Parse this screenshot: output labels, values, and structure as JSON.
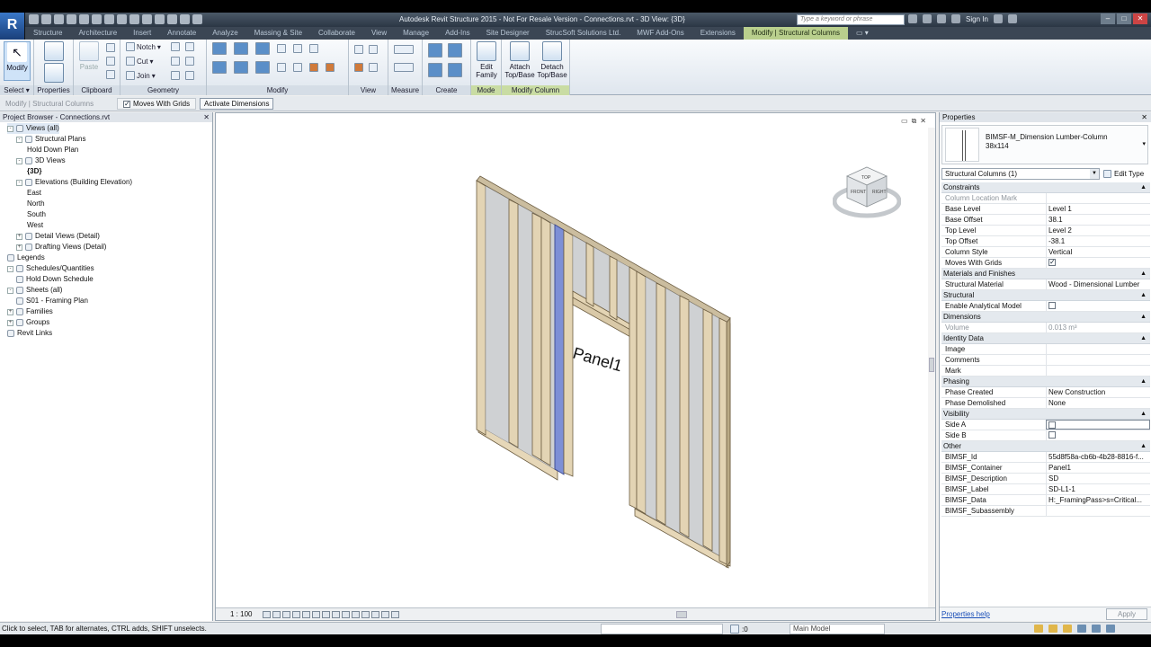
{
  "title_bar": {
    "app_title": "Autodesk Revit Structure 2015 - Not For Resale Version -    Connections.rvt - 3D View: {3D}",
    "search_placeholder": "Type a keyword or phrase",
    "sign_in": "Sign In"
  },
  "ribbon_tabs": [
    "Structure",
    "Architecture",
    "Insert",
    "Annotate",
    "Analyze",
    "Massing & Site",
    "Collaborate",
    "View",
    "Manage",
    "Add-Ins",
    "Site Designer",
    "StrucSoft Solutions Ltd.",
    "MWF Add-Ons",
    "Extensions",
    "Modify | Structural Columns"
  ],
  "ribbon": {
    "select": {
      "label": "Select",
      "modify": "Modify"
    },
    "properties": {
      "label": "Properties"
    },
    "clipboard": {
      "label": "Clipboard",
      "paste": "Paste"
    },
    "geometry": {
      "label": "Geometry",
      "notch": "Notch",
      "cut": "Cut",
      "join": "Join"
    },
    "modify": {
      "label": "Modify"
    },
    "view": {
      "label": "View"
    },
    "measure": {
      "label": "Measure"
    },
    "create": {
      "label": "Create"
    },
    "mode": {
      "label": "Mode",
      "edit_family": "Edit Family"
    },
    "modify_column": {
      "label": "Modify Column",
      "attach": "Attach Top/Base",
      "detach": "Detach Top/Base"
    }
  },
  "options_bar": {
    "context": "Modify | Structural Columns",
    "moves_with_grids": "Moves With Grids",
    "moves_with_grids_checked": true,
    "activate_dimensions": "Activate Dimensions"
  },
  "project_browser": {
    "title": "Project Browser - Connections.rvt",
    "items": [
      {
        "label": "Views (all)",
        "pm": "-",
        "selected": true
      },
      {
        "label": "Structural Plans",
        "pm": "-"
      },
      {
        "label": "Hold Down Plan",
        "pm": ""
      },
      {
        "label": "3D Views",
        "pm": "-"
      },
      {
        "label": "{3D}",
        "pm": "",
        "bold": true
      },
      {
        "label": "Elevations (Building Elevation)",
        "pm": "-"
      },
      {
        "label": "East",
        "pm": ""
      },
      {
        "label": "North",
        "pm": ""
      },
      {
        "label": "South",
        "pm": ""
      },
      {
        "label": "West",
        "pm": ""
      },
      {
        "label": "Detail Views (Detail)",
        "pm": "+"
      },
      {
        "label": "Drafting Views (Detail)",
        "pm": "+"
      },
      {
        "label": "Legends",
        "pm": ""
      },
      {
        "label": "Schedules/Quantities",
        "pm": "-"
      },
      {
        "label": "Hold Down Schedule",
        "pm": ""
      },
      {
        "label": "Sheets (all)",
        "pm": "-"
      },
      {
        "label": "S01 - Framing Plan",
        "pm": ""
      },
      {
        "label": "Families",
        "pm": "+"
      },
      {
        "label": "Groups",
        "pm": "+"
      },
      {
        "label": "Revit Links",
        "pm": ""
      }
    ]
  },
  "viewport": {
    "tag_text": "Panel1",
    "scale": "1 : 100",
    "viewcube": {
      "top": "TOP",
      "front": "FRONT",
      "right": "RIGHT"
    }
  },
  "properties": {
    "title": "Properties",
    "type_name_line1": "BIMSF-M_Dimension Lumber-Column",
    "type_name_line2": "38x114",
    "filter": "Structural Columns (1)",
    "edit_type": "Edit Type",
    "groups": [
      {
        "name": "Constraints",
        "rows": [
          {
            "k": "Column Location Mark",
            "v": "",
            "dim": true
          },
          {
            "k": "Base Level",
            "v": "Level 1"
          },
          {
            "k": "Base Offset",
            "v": "38.1"
          },
          {
            "k": "Top Level",
            "v": "Level 2"
          },
          {
            "k": "Top Offset",
            "v": "-38.1"
          },
          {
            "k": "Column Style",
            "v": "Vertical"
          },
          {
            "k": "Moves With Grids",
            "v": "",
            "check": true,
            "checked": true
          }
        ]
      },
      {
        "name": "Materials and Finishes",
        "rows": [
          {
            "k": "Structural Material",
            "v": "Wood - Dimensional Lumber"
          }
        ]
      },
      {
        "name": "Structural",
        "rows": [
          {
            "k": "Enable Analytical Model",
            "v": "",
            "check": true,
            "checked": false
          }
        ]
      },
      {
        "name": "Dimensions",
        "rows": [
          {
            "k": "Volume",
            "v": "0.013 m³",
            "dim": true
          }
        ]
      },
      {
        "name": "Identity Data",
        "rows": [
          {
            "k": "Image",
            "v": ""
          },
          {
            "k": "Comments",
            "v": ""
          },
          {
            "k": "Mark",
            "v": ""
          }
        ]
      },
      {
        "name": "Phasing",
        "rows": [
          {
            "k": "Phase Created",
            "v": "New Construction"
          },
          {
            "k": "Phase Demolished",
            "v": "None"
          }
        ]
      },
      {
        "name": "Visibility",
        "rows": [
          {
            "k": "Side A",
            "v": "",
            "check": true,
            "checked": false,
            "boxed": true
          },
          {
            "k": "Side B",
            "v": "",
            "check": true,
            "checked": false
          }
        ]
      },
      {
        "name": "Other",
        "rows": [
          {
            "k": "BIMSF_Id",
            "v": "55d8f58a-cb6b-4b28-8816-f..."
          },
          {
            "k": "BIMSF_Container",
            "v": "Panel1"
          },
          {
            "k": "BIMSF_Description",
            "v": "SD"
          },
          {
            "k": "BIMSF_Label",
            "v": "SD-L1-1"
          },
          {
            "k": "BIMSF_Data",
            "v": "H:_FramingPass>s=Critical..."
          },
          {
            "k": "BIMSF_Subassembly",
            "v": ""
          }
        ]
      }
    ],
    "help": "Properties help",
    "apply": "Apply"
  },
  "status_bar": {
    "text": "Click to select, TAB for alternates, CTRL adds, SHIFT unselects.",
    "selection_count": ":0",
    "model": "Main Model"
  },
  "colors": {
    "ribbon_tab_bg": "#3b4654",
    "context_tab": "#b9cf8d",
    "stud": "#e3d4b4",
    "selected": "#7d8fd6"
  }
}
